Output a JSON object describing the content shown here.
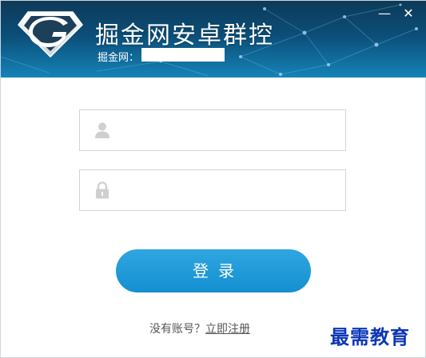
{
  "app": {
    "title": "掘金网安卓群控",
    "site_label": "掘金网：",
    "site_value": ""
  },
  "window_controls": {
    "minimize": "—",
    "close": "✕"
  },
  "form": {
    "username_value": "",
    "username_placeholder": "",
    "password_value": "",
    "password_placeholder": "",
    "login_label": "登录"
  },
  "footer": {
    "prompt": "没有账号？",
    "register_label": "立即注册"
  },
  "watermark": "最需教育",
  "icons": {
    "logo": "diamond-g-logo-icon",
    "user": "user-icon",
    "lock": "lock-icon"
  },
  "colors": {
    "banner_dark": "#0d3a58",
    "banner_light": "#1583b8",
    "button": "#1b96d4",
    "watermark": "#0c36b8"
  }
}
